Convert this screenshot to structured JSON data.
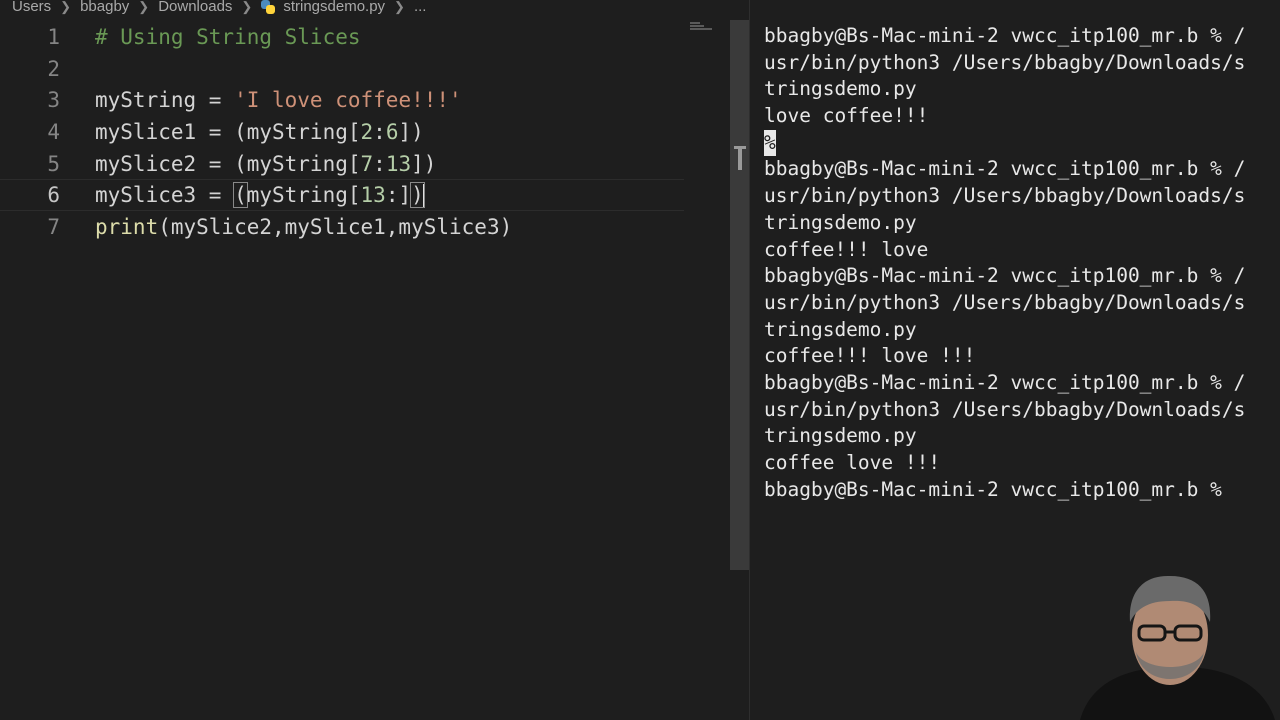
{
  "breadcrumb": {
    "items": [
      "Users",
      "bbagby",
      "Downloads",
      "stringsdemo.py",
      "..."
    ]
  },
  "editor": {
    "lines": [
      {
        "num": "1",
        "text": "# Using String Slices"
      },
      {
        "num": "2",
        "text": ""
      },
      {
        "num": "3",
        "prefix": "myString = ",
        "string": "'I love coffee!!!'"
      },
      {
        "num": "4",
        "a": "mySlice1 = (myString[",
        "n1": "2",
        "colon": ":",
        "n2": "6",
        "b": "])"
      },
      {
        "num": "5",
        "a": "mySlice2 = (myString[",
        "n1": "7",
        "colon": ":",
        "n2": "13",
        "b": "])"
      },
      {
        "num": "6",
        "a": "mySlice3 = ",
        "open": "(",
        "mid": "myString[",
        "n1": "13",
        "colon": ":]",
        "close": ")"
      },
      {
        "num": "7",
        "fn": "print",
        "rest": "(mySlice2,mySlice1,mySlice3)"
      }
    ]
  },
  "terminal": {
    "lines": [
      "bbagby@Bs-Mac-mini-2 vwcc_itp100_mr.b % /",
      "usr/bin/python3 /Users/bbagby/Downloads/s",
      "tringsdemo.py",
      "love coffee!!!",
      "%",
      "bbagby@Bs-Mac-mini-2 vwcc_itp100_mr.b % /",
      "usr/bin/python3 /Users/bbagby/Downloads/s",
      "tringsdemo.py",
      "coffee!!! love",
      "bbagby@Bs-Mac-mini-2 vwcc_itp100_mr.b % /",
      "usr/bin/python3 /Users/bbagby/Downloads/s",
      "tringsdemo.py",
      "coffee!!! love !!!",
      "bbagby@Bs-Mac-mini-2 vwcc_itp100_mr.b % /",
      "usr/bin/python3 /Users/bbagby/Downloads/s",
      "tringsdemo.py",
      "coffee love !!!",
      "bbagby@Bs-Mac-mini-2 vwcc_itp100_mr.b % "
    ]
  },
  "colors": {
    "background": "#1e1e1e",
    "comment": "#6a9955",
    "string": "#ce9178",
    "number": "#b5cea8",
    "function": "#dcdcaa"
  }
}
